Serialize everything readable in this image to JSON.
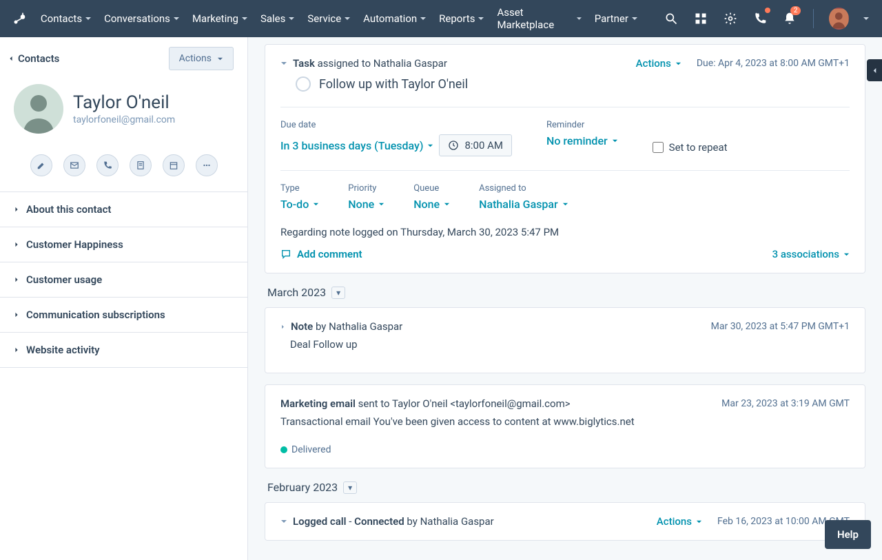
{
  "nav": {
    "items": [
      "Contacts",
      "Conversations",
      "Marketing",
      "Sales",
      "Service",
      "Automation",
      "Reports",
      "Asset Marketplace",
      "Partner"
    ],
    "notif_count": "2"
  },
  "side": {
    "back_label": "Contacts",
    "actions_label": "Actions",
    "contact_name": "Taylor O'neil",
    "contact_email": "taylorfoneil@gmail.com",
    "accordion": [
      "About this contact",
      "Customer Happiness",
      "Customer usage",
      "Communication subscriptions",
      "Website activity"
    ]
  },
  "task_card": {
    "prefix": "Task",
    "middle": " assigned to ",
    "name": "Nathalia Gaspar",
    "actions_label": "Actions",
    "due_label": "Due: Apr 4, 2023 at 8:00 AM GMT+1",
    "sub_title": "Follow up with Taylor O'neil",
    "due_date_label": "Due date",
    "due_date_value": "In 3 business days (Tuesday)",
    "time_value": "8:00 AM",
    "reminder_label": "Reminder",
    "reminder_value": "No reminder",
    "repeat_label": "Set to repeat",
    "type_label": "Type",
    "type_value": "To-do",
    "priority_label": "Priority",
    "priority_value": "None",
    "queue_label": "Queue",
    "queue_value": "None",
    "assigned_label": "Assigned to",
    "assigned_value": "Nathalia Gaspar",
    "body": "Regarding note logged on Thursday, March 30, 2023 5:47 PM",
    "add_comment": "Add comment",
    "assoc": "3 associations"
  },
  "sections": {
    "march": "March 2023",
    "february": "February 2023"
  },
  "note_card": {
    "prefix": "Note",
    "middle": " by ",
    "name": "Nathalia Gaspar",
    "timestamp": "Mar 30, 2023 at 5:47 PM GMT+1",
    "body": "Deal Follow up"
  },
  "email_card": {
    "prefix": "Marketing email",
    "middle": " sent to ",
    "recipient": "Taylor O'neil <taylorfoneil@gmail.com>",
    "timestamp": "Mar 23, 2023 at 3:19 AM GMT",
    "body": "Transactional email You've been given access to content at www.biglytics.net",
    "status_label": "Delivered",
    "status_color": "#00bda5"
  },
  "call_card": {
    "prefix": "Logged call",
    "dash": " - ",
    "status": "Connected",
    "middle": " by ",
    "name": "Nathalia Gaspar",
    "actions_label": "Actions",
    "timestamp": "Feb 16, 2023 at 10:00 AM GMT"
  },
  "help_label": "Help"
}
